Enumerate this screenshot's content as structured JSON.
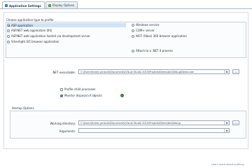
{
  "tabs": [
    {
      "label": "Application Settings",
      "active": true
    },
    {
      "label": "Display Options",
      "active": false
    }
  ],
  "app_type": {
    "title": "Choose application type to profile",
    "options_left": [
      {
        "label": "ASP application",
        "checked": true,
        "selected": true
      },
      {
        "label": "ASP.NET web application (IIS)",
        "checked": false
      },
      {
        "label": "ASP.NET web application hosted via development server",
        "checked": false
      },
      {
        "label": "Silverlight 4/5 browser application",
        "checked": false
      }
    ],
    "options_right": [
      {
        "label": "Windows service",
        "checked": false
      },
      {
        "label": "COM+ server",
        "checked": false
      },
      {
        "label": "WCF (Xbox) 360 browser application",
        "checked": false
      }
    ],
    "attach_label": "Attach to a .NET 4 process"
  },
  "exe": {
    "label": ".NET executable:",
    "value": "C:\\Users\\frame.yanecek\\Documents\\Visual Studio 2015\\Projects\\Demo\\bin\\Debug\\Demo.exe",
    "browse": "..."
  },
  "exe_options": [
    {
      "label": "Profile child processes",
      "checked": false
    },
    {
      "label": "Monitor disposal of objects",
      "checked": true
    }
  ],
  "startup": {
    "title": "Startup Options",
    "working_dir_label": "Working directory:",
    "working_dir_value": "C:\\Users\\frame.yanecek\\Documents\\Visual Studio 2015\\Projects\\Demo\\bin\\Debug",
    "args_label": "Arguments:",
    "args_value": "",
    "browse": "..."
  },
  "footer": {
    "link": "Learn more about profiling"
  }
}
